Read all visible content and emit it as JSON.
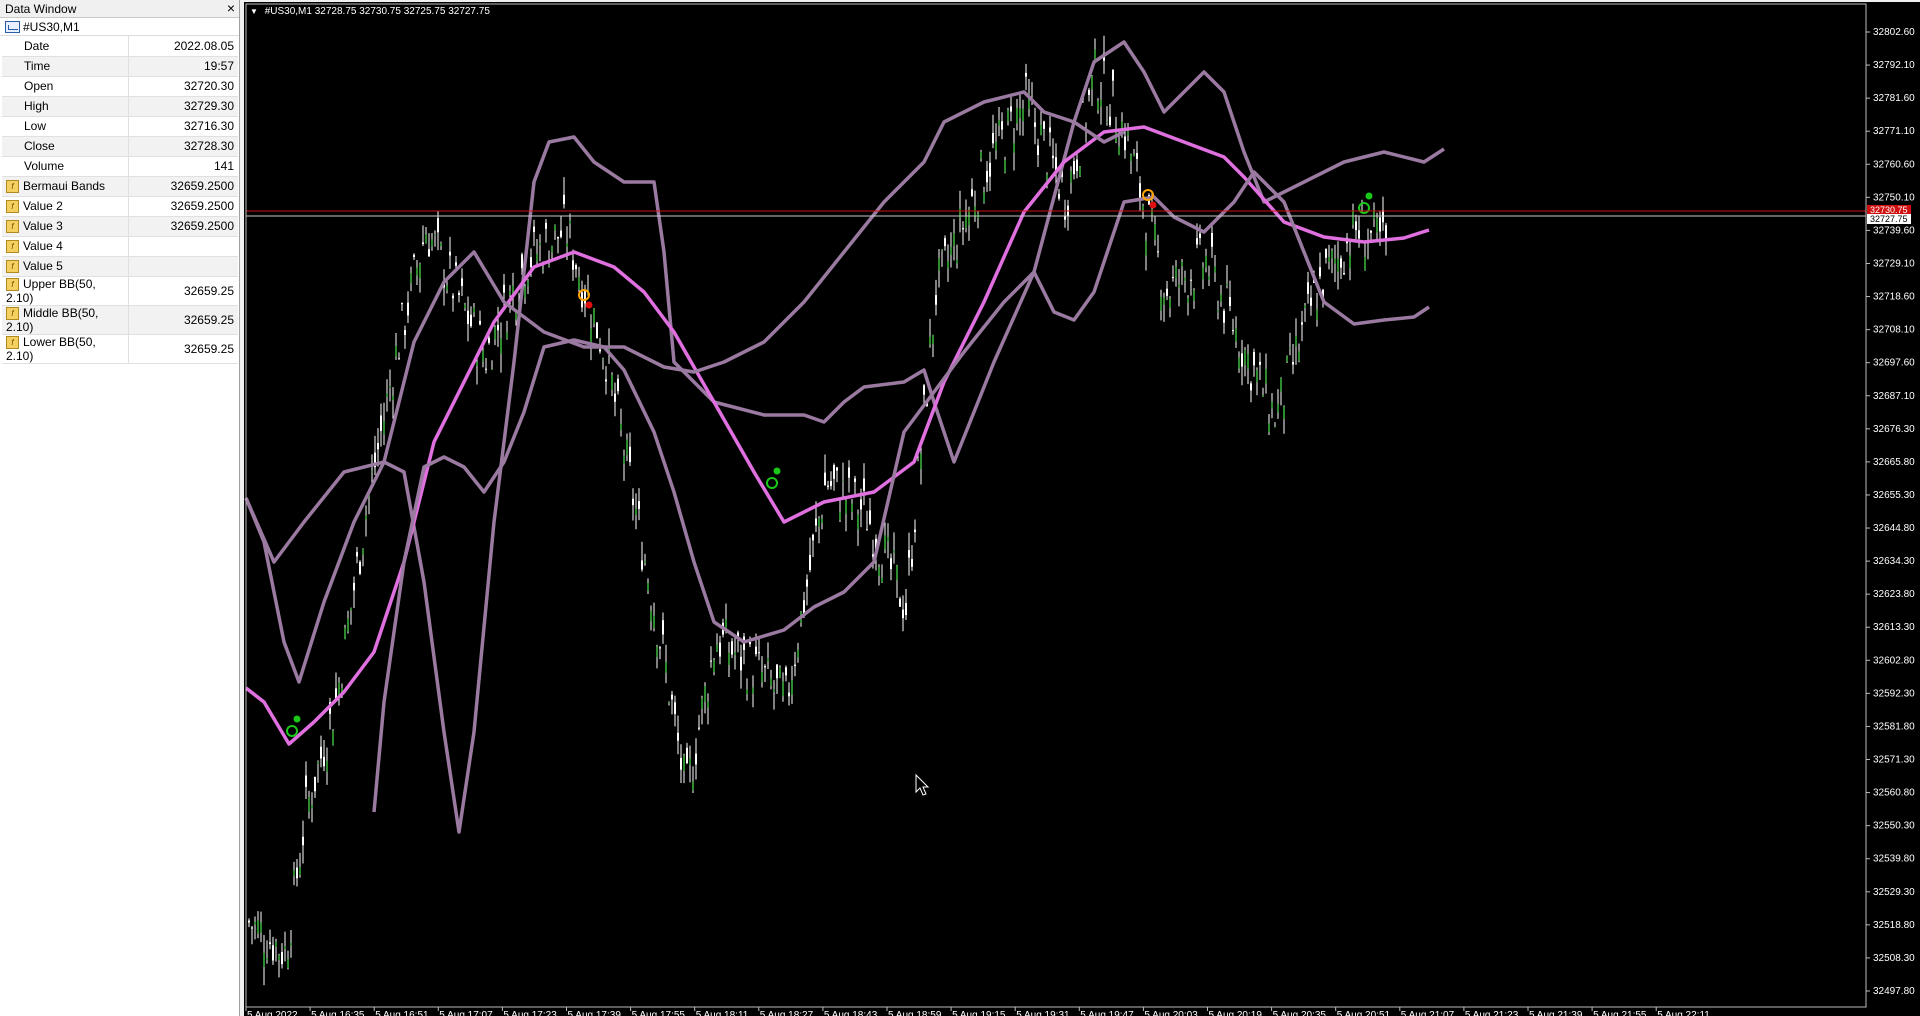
{
  "data_window": {
    "title": "Data Window",
    "close_glyph": "×",
    "symbol": "#US30,M1",
    "rows": [
      {
        "label": "Date",
        "value": "2022.08.05",
        "indicator": false
      },
      {
        "label": "Time",
        "value": "19:57",
        "indicator": false
      },
      {
        "label": "Open",
        "value": "32720.30",
        "indicator": false
      },
      {
        "label": "High",
        "value": "32729.30",
        "indicator": false
      },
      {
        "label": "Low",
        "value": "32716.30",
        "indicator": false
      },
      {
        "label": "Close",
        "value": "32728.30",
        "indicator": false
      },
      {
        "label": "Volume",
        "value": "141",
        "indicator": false
      },
      {
        "label": "Bermaui Bands",
        "value": "32659.2500",
        "indicator": true
      },
      {
        "label": "Value 2",
        "value": "32659.2500",
        "indicator": true
      },
      {
        "label": "Value 3",
        "value": "32659.2500",
        "indicator": true
      },
      {
        "label": "Value 4",
        "value": "",
        "indicator": true
      },
      {
        "label": "Value 5",
        "value": "",
        "indicator": true
      },
      {
        "label": "Upper BB(50, 2.10)",
        "value": "32659.25",
        "indicator": true
      },
      {
        "label": "Middle BB(50, 2.10)",
        "value": "32659.25",
        "indicator": true
      },
      {
        "label": "Lower BB(50, 2.10)",
        "value": "32659.25",
        "indicator": true
      }
    ]
  },
  "chart": {
    "header_arrow": "▼",
    "header": "#US30,M1  32728.75 32730.75 32725.75 32727.75",
    "price_labels": [
      "32802.60",
      "32792.10",
      "32781.60",
      "32771.10",
      "32760.60",
      "32750.10",
      "32739.60",
      "32729.10",
      "32718.60",
      "32708.10",
      "32697.60",
      "32687.10",
      "32676.30",
      "32665.80",
      "32655.30",
      "32644.80",
      "32634.30",
      "32623.80",
      "32613.30",
      "32602.80",
      "32592.30",
      "32581.80",
      "32571.30",
      "32560.80",
      "32550.30",
      "32539.80",
      "32529.30",
      "32518.80",
      "32508.30",
      "32497.80"
    ],
    "time_labels": [
      "5 Aug 2022",
      "5 Aug 16:35",
      "5 Aug 16:51",
      "5 Aug 17:07",
      "5 Aug 17:23",
      "5 Aug 17:39",
      "5 Aug 17:55",
      "5 Aug 18:11",
      "5 Aug 18:27",
      "5 Aug 18:43",
      "5 Aug 18:59",
      "5 Aug 19:15",
      "5 Aug 19:31",
      "5 Aug 19:47",
      "5 Aug 20:03",
      "5 Aug 20:19",
      "5 Aug 20:35",
      "5 Aug 20:51",
      "5 Aug 21:07",
      "5 Aug 21:23",
      "5 Aug 21:39",
      "5 Aug 21:55",
      "5 Aug 22:11"
    ],
    "current_price_label": "32727.75",
    "ask_price_label": "32730.75",
    "colors": {
      "background": "#000000",
      "candles": "#ffffff",
      "bands": "#9a7aa0",
      "middle": "#e070e0",
      "ask_line": "#d01010",
      "bid_line": "#c8c8c8"
    }
  }
}
